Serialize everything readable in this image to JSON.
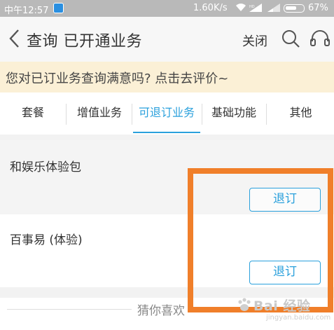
{
  "status_bar": {
    "carrier_time": "中午12:57",
    "network_speed": "1.60K/s",
    "battery_percent": "67%",
    "battery_level": 0.67,
    "icons": [
      "app-notification-icon",
      "wifi-icon",
      "signal-icon",
      "signal-icon",
      "battery-icon"
    ]
  },
  "header": {
    "title": "查询 已开通业务",
    "close_label": "关闭",
    "icons": [
      "back-arrow-icon",
      "search-icon",
      "headset-icon"
    ]
  },
  "feedback_banner": {
    "text": "您对已订业务查询满意吗? 点击去评价~"
  },
  "tabs": [
    {
      "label": "套餐",
      "active": false
    },
    {
      "label": "增值业务",
      "active": false
    },
    {
      "label": "可退订业务",
      "active": true
    },
    {
      "label": "基础功能",
      "active": false
    },
    {
      "label": "其他",
      "active": false
    }
  ],
  "services": [
    {
      "name": "和娱乐体验包",
      "action_label": "退订"
    },
    {
      "name": "百事易 (体验)",
      "action_label": "退订"
    }
  ],
  "recommend": {
    "text": "猜你喜欢"
  },
  "watermark": {
    "main": "Bai 经验",
    "sub": "jingyan.baidu.com"
  },
  "colors": {
    "accent": "#2aa0dc",
    "highlight_border": "#f07f2a",
    "banner_bg": "#fbf0d6",
    "status_bar_bg": "#b9b9b9"
  }
}
